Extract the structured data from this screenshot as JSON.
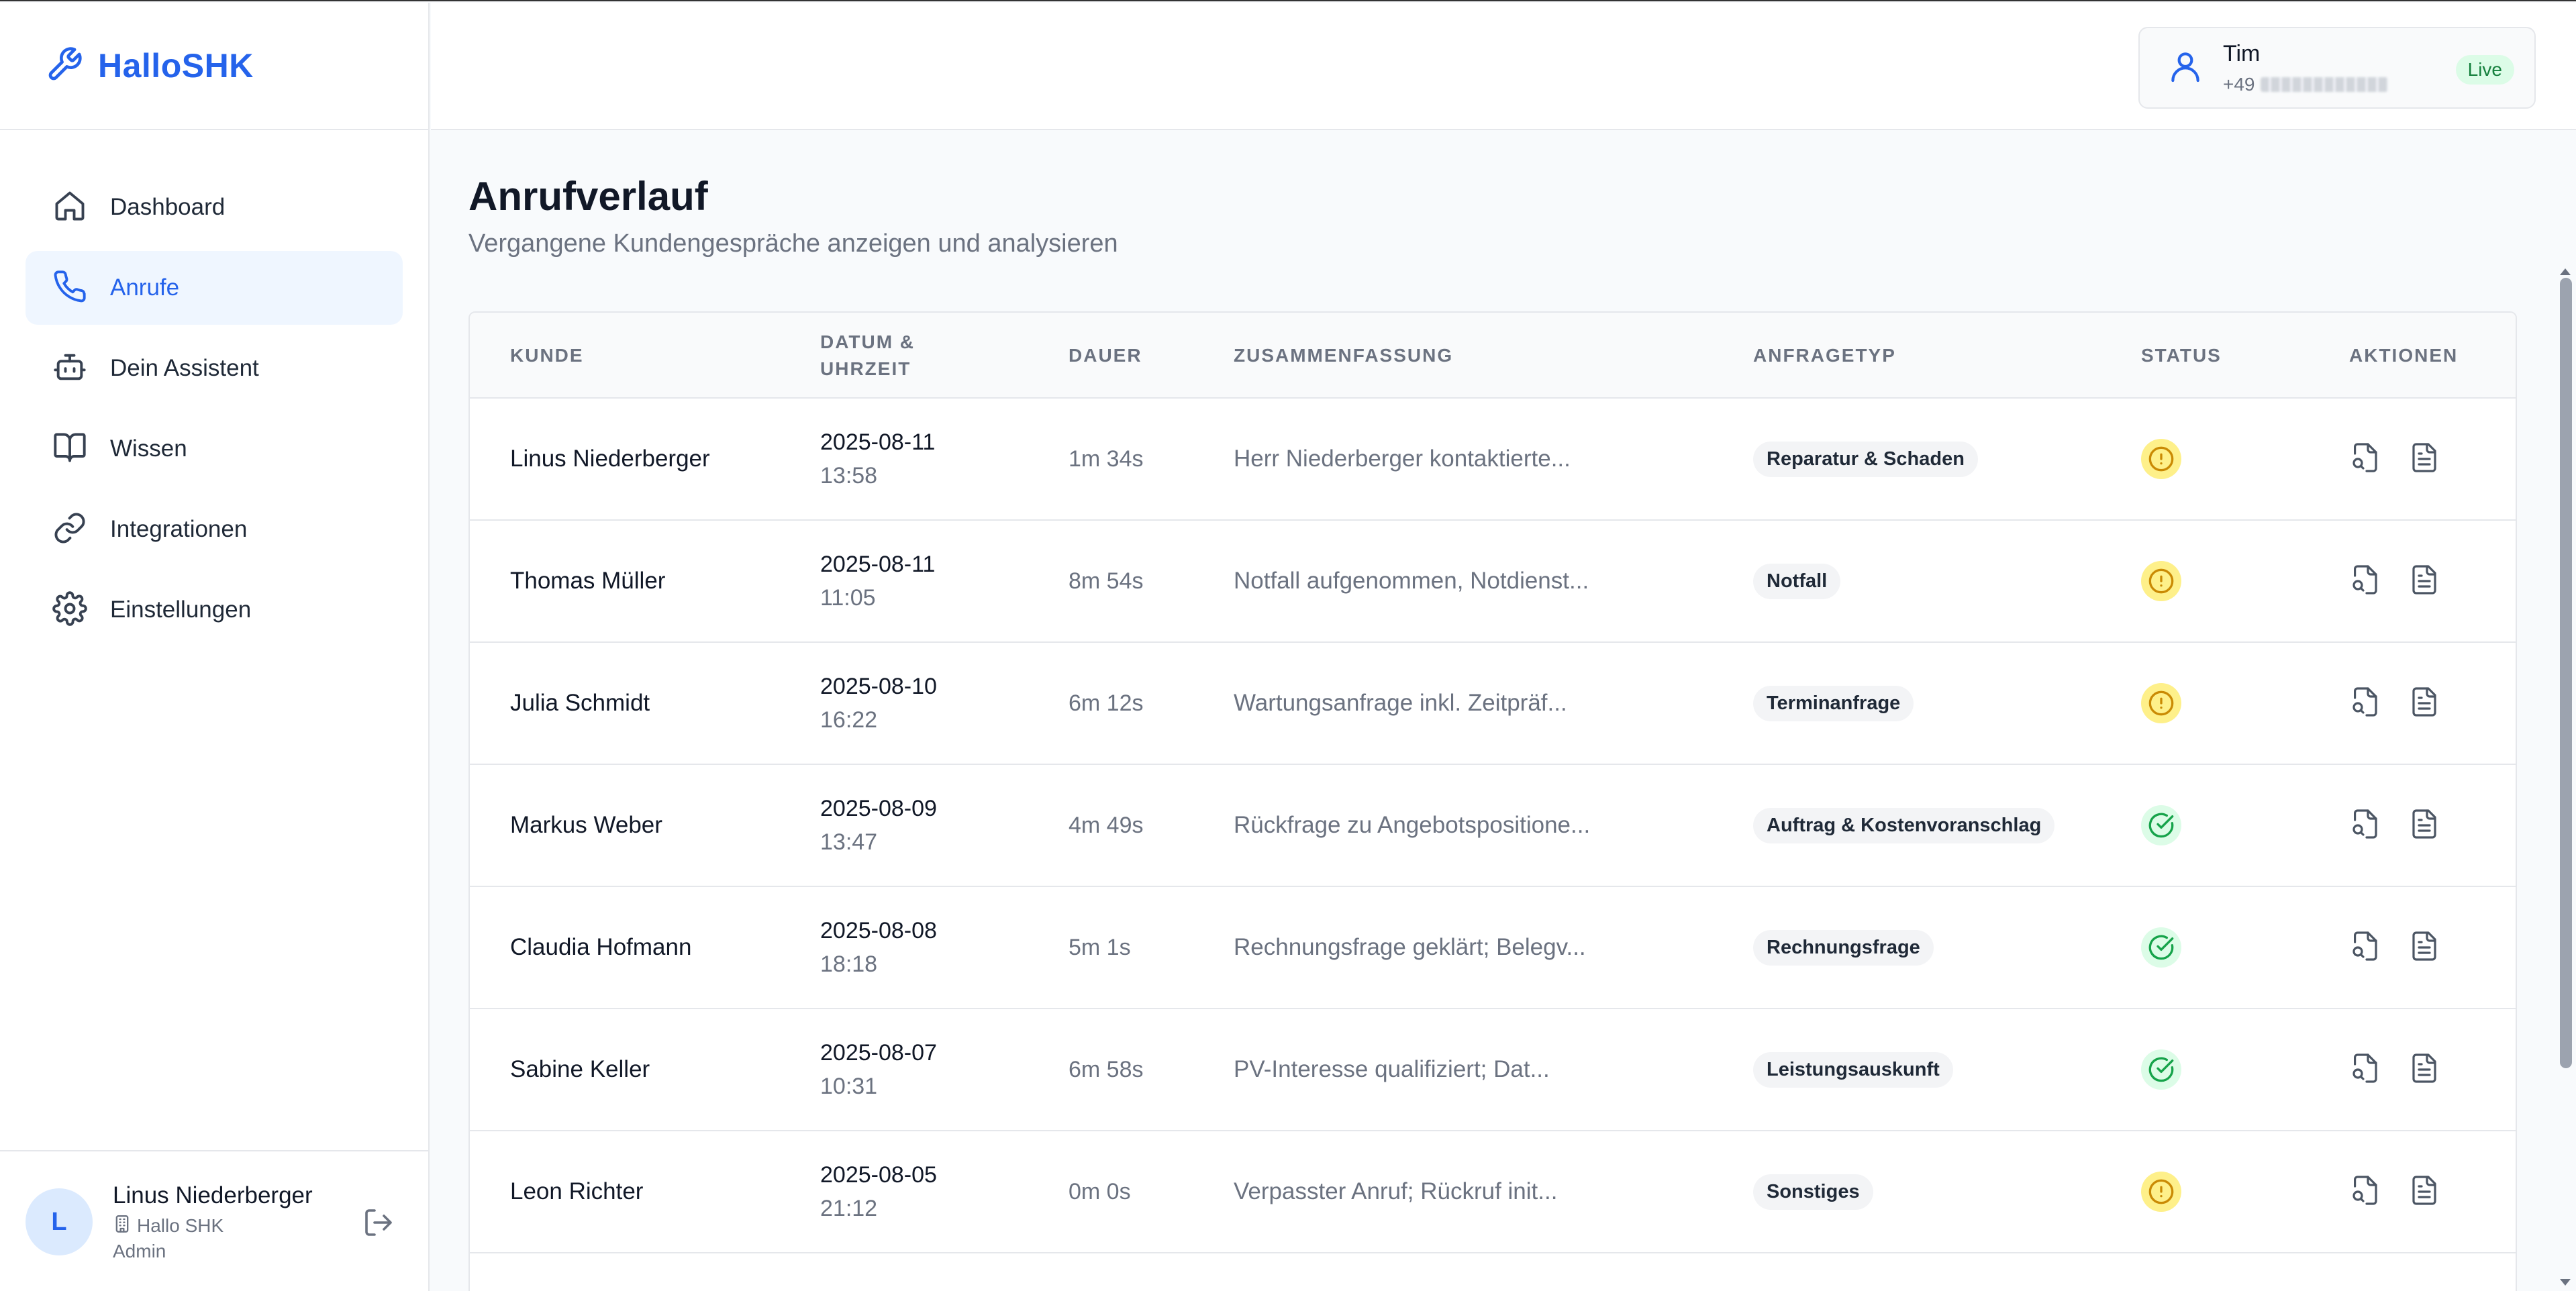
{
  "brand": {
    "name": "HalloSHK"
  },
  "nav": [
    {
      "label": "Dashboard",
      "icon": "home-icon",
      "active": false
    },
    {
      "label": "Anrufe",
      "icon": "phone-icon",
      "active": true
    },
    {
      "label": "Dein Assistent",
      "icon": "bot-icon",
      "active": false
    },
    {
      "label": "Wissen",
      "icon": "book-icon",
      "active": false
    },
    {
      "label": "Integrationen",
      "icon": "link-icon",
      "active": false
    },
    {
      "label": "Einstellungen",
      "icon": "gear-icon",
      "active": false
    }
  ],
  "user": {
    "initial": "L",
    "name": "Linus Niederberger",
    "company": "Hallo SHK",
    "role": "Admin"
  },
  "header": {
    "profile_name": "Tim",
    "phone_prefix": "+49",
    "live_label": "Live"
  },
  "page": {
    "title": "Anrufverlauf",
    "subtitle": "Vergangene Kundengespräche anzeigen und analysieren"
  },
  "table": {
    "columns": {
      "kunde": "KUNDE",
      "datum": "DATUM &",
      "uhrzeit": "UHRZEIT",
      "dauer": "DAUER",
      "zusammenfassung": "ZUSAMMENFASSUNG",
      "anfragetyp": "ANFRAGETYP",
      "status": "STATUS",
      "aktionen": "AKTIONEN"
    },
    "rows": [
      {
        "name": "Linus Niederberger",
        "date": "2025-08-11",
        "time": "13:58",
        "duration": "1m 34s",
        "summary": "Herr Niederberger kontaktierte...",
        "type": "Reparatur & Schaden",
        "status": "pending"
      },
      {
        "name": "Thomas Müller",
        "date": "2025-08-11",
        "time": "11:05",
        "duration": "8m 54s",
        "summary": "Notfall aufgenommen, Notdienst...",
        "type": "Notfall",
        "status": "pending"
      },
      {
        "name": "Julia Schmidt",
        "date": "2025-08-10",
        "time": "16:22",
        "duration": "6m 12s",
        "summary": "Wartungsanfrage inkl. Zeitpräf...",
        "type": "Terminanfrage",
        "status": "pending"
      },
      {
        "name": "Markus Weber",
        "date": "2025-08-09",
        "time": "13:47",
        "duration": "4m 49s",
        "summary": "Rückfrage zu Angebotspositione...",
        "type": "Auftrag & Kostenvoranschlag",
        "status": "done"
      },
      {
        "name": "Claudia Hofmann",
        "date": "2025-08-08",
        "time": "18:18",
        "duration": "5m 1s",
        "summary": "Rechnungsfrage geklärt; Belegv...",
        "type": "Rechnungsfrage",
        "status": "done"
      },
      {
        "name": "Sabine Keller",
        "date": "2025-08-07",
        "time": "10:31",
        "duration": "6m 58s",
        "summary": "PV-Interesse qualifiziert; Dat...",
        "type": "Leistungsauskunft",
        "status": "done"
      },
      {
        "name": "Leon Richter",
        "date": "2025-08-05",
        "time": "21:12",
        "duration": "0m 0s",
        "summary": "Verpasster Anruf; Rückruf init...",
        "type": "Sonstiges",
        "status": "pending"
      }
    ]
  },
  "colors": {
    "accent": "#2563eb",
    "pending": "#fef08a",
    "pending_icon": "#ca8a04",
    "done": "#dcfce7",
    "done_icon": "#16a34a"
  }
}
